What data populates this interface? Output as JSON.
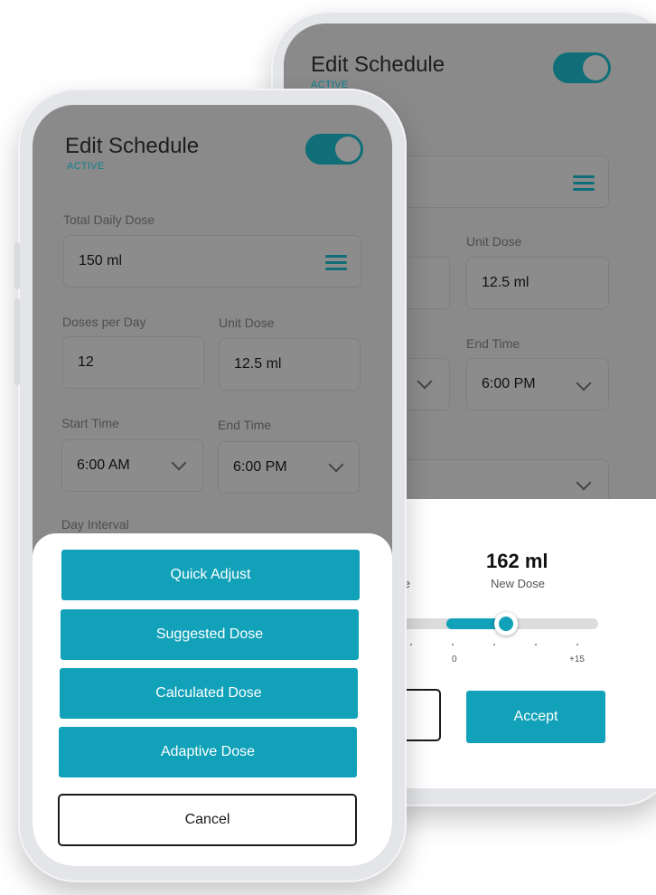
{
  "back_phone": {
    "title": "Edit Schedule",
    "status": "ACTIVE",
    "unit_dose_label": "Unit Dose",
    "unit_dose_value": "12.5 ml",
    "end_time_label": "End Time",
    "end_time_value": "6:00 PM",
    "percent_symbol": "%",
    "change_label": "hange",
    "new_dose_value": "162 ml",
    "new_dose_label": "New Dose",
    "slider": {
      "tick_zero": "0",
      "tick_max": "+15",
      "level": 0.57
    },
    "accept_label": "Accept"
  },
  "front_phone": {
    "title": "Edit Schedule",
    "status": "ACTIVE",
    "total_daily_dose_label": "Total Daily Dose",
    "total_daily_dose_value": "150 ml",
    "doses_per_day_label": "Doses per Day",
    "doses_per_day_value": "12",
    "unit_dose_label": "Unit Dose",
    "unit_dose_value": "12.5 ml",
    "start_time_label": "Start Time",
    "start_time_value": "6:00 AM",
    "end_time_label": "End Time",
    "end_time_value": "6:00 PM",
    "day_interval_label": "Day Interval",
    "actions": [
      {
        "label": "Quick Adjust"
      },
      {
        "label": "Suggested Dose"
      },
      {
        "label": "Calculated Dose"
      },
      {
        "label": "Adaptive Dose"
      }
    ],
    "cancel_label": "Cancel"
  },
  "colors": {
    "accent": "#11a1b8",
    "toggle": "#0f6e78",
    "dim_overlay": "#8a8a8a"
  }
}
